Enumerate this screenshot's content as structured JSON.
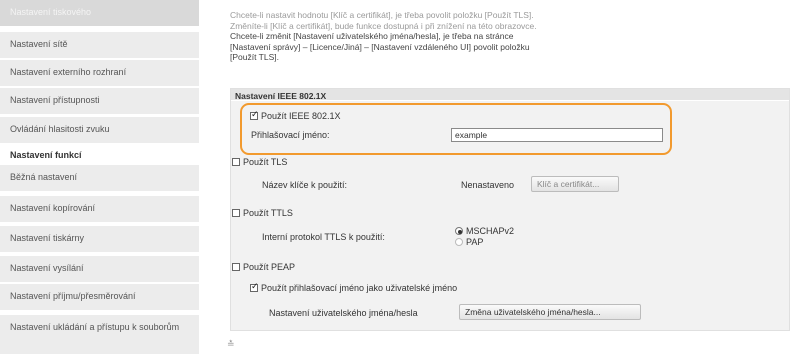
{
  "sidebar": {
    "items": [
      {
        "label": "Nastavení tiskového"
      },
      {
        "label": "Nastavení sítě"
      },
      {
        "label": "Nastavení externího rozhraní"
      },
      {
        "label": "Nastavení přístupnosti"
      },
      {
        "label": "Ovládání hlasitosti zvuku"
      }
    ],
    "header": "Nastavení funkcí",
    "items2": [
      {
        "label": "Běžná nastavení"
      },
      {
        "label": "Nastavení kopírování"
      },
      {
        "label": "Nastavení tiskárny"
      },
      {
        "label": "Nastavení vysílání"
      },
      {
        "label": "Nastavení příjmu/přesměrování"
      },
      {
        "label": "Nastavení ukládání a přístupu k souborům"
      }
    ]
  },
  "intro": {
    "line1": "Chcete-li nastavit hodnotu [Klíč a certifikát], je třeba povolit položku [Použít TLS].",
    "line2": "Změníte-li [Klíč a certifikát], bude funkce dostupná i při znížení na této obrazovce.",
    "line3": "Chcete-li změnit [Nastavení uživatelského jména/hesla], je třeba na stránce",
    "line4": "[Nastavení správy] – [Licence/Jiná] – [Nastavení vzdáleného UI] povolit položku",
    "line5": "[Použít TLS]."
  },
  "panel": {
    "title": "Nastavení IEEE 802.1X",
    "use_ieee_label": "Použít IEEE 802.1X",
    "use_ieee_checked": true,
    "login_name_label": "Přihlašovací jméno:",
    "login_name_value": "example",
    "use_tls_label": "Použít TLS",
    "use_tls_checked": false,
    "key_name_label": "Název klíče k použití:",
    "key_status": "Nenastaveno",
    "key_button": "Klíč a certifikát...",
    "use_ttls_label": "Použít TTLS",
    "use_ttls_checked": false,
    "ttls_protocol_label": "Interní protokol TTLS k použití:",
    "ttls_option_1": "MSCHAPv2",
    "ttls_option_2": "PAP",
    "use_peap_label": "Použít PEAP",
    "use_peap_checked": false,
    "use_login_as_user_label": "Použít přihlašovací jméno jako uživatelské jméno",
    "use_login_as_user_checked": true,
    "user_settings_label": "Nastavení uživatelského jména/hesla",
    "user_settings_button": "Změna uživatelského jména/hesla..."
  },
  "footer": {
    "scroll_top": "≛"
  },
  "colors": {
    "highlight": "#f29a2e"
  }
}
